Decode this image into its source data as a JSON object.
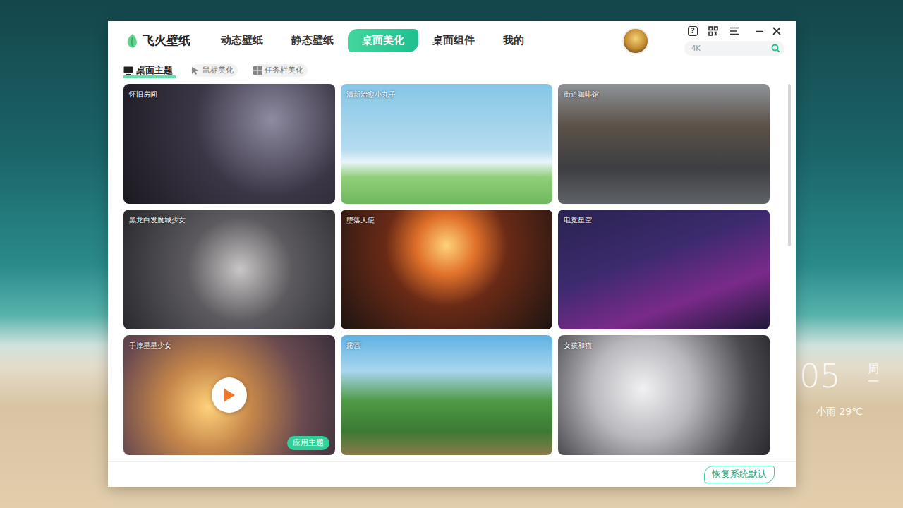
{
  "desktop": {
    "clock": "05",
    "weekday": "周一",
    "weather": "小雨 29℃"
  },
  "window": {
    "app_name": "飞火壁纸",
    "help": "?",
    "search": {
      "placeholder": "4K"
    }
  },
  "tabs": [
    {
      "label": "动态壁纸",
      "selected": false
    },
    {
      "label": "静态壁纸",
      "selected": false
    },
    {
      "label": "桌面美化",
      "selected": true
    },
    {
      "label": "桌面组件",
      "selected": false
    },
    {
      "label": "我的",
      "selected": false
    }
  ],
  "subtabs": [
    {
      "label": "桌面主题",
      "selected": true,
      "kind": "monitor"
    },
    {
      "label": "鼠标美化",
      "selected": false,
      "kind": "cursor"
    },
    {
      "label": "任务栏美化",
      "selected": false,
      "kind": "windows"
    }
  ],
  "themes": [
    {
      "title": "怀旧房间",
      "hovered": false
    },
    {
      "title": "清新治愈小丸子",
      "hovered": false
    },
    {
      "title": "街道咖啡馆",
      "hovered": false
    },
    {
      "title": "黑龙白发魔城少女",
      "hovered": false
    },
    {
      "title": "堕落天使",
      "hovered": false
    },
    {
      "title": "电竞星空",
      "hovered": false
    },
    {
      "title": "手捧星星少女",
      "hovered": true
    },
    {
      "title": "露营",
      "hovered": false
    },
    {
      "title": "女孩和猫",
      "hovered": false
    }
  ],
  "apply_button": "应用主题",
  "restore_button": "恢复系统默认"
}
